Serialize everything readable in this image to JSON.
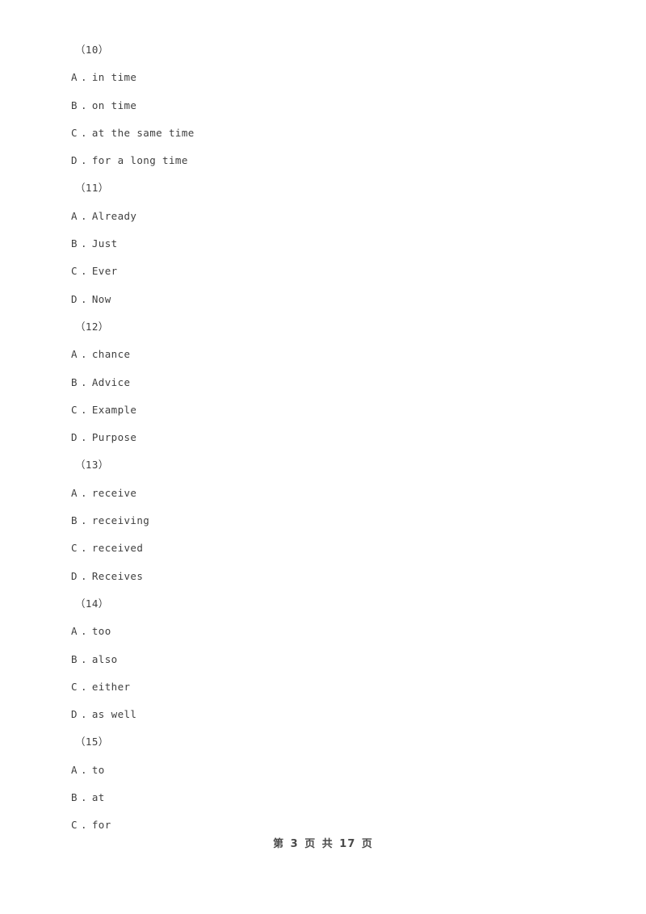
{
  "document": {
    "page_label_prefix": "第",
    "page_current": "3",
    "page_unit": "页",
    "page_total_prefix": "共",
    "page_total": "17",
    "page_total_unit": "页"
  },
  "questions": [
    {
      "number": "（10）",
      "options": [
        {
          "letter": "A",
          "separator": ".",
          "text": "in time"
        },
        {
          "letter": "B",
          "separator": ".",
          "text": "on time"
        },
        {
          "letter": "C",
          "separator": ".",
          "text": "at the same time"
        },
        {
          "letter": "D",
          "separator": ".",
          "text": "for a long time"
        }
      ]
    },
    {
      "number": "（11）",
      "options": [
        {
          "letter": "A",
          "separator": ".",
          "text": "Already"
        },
        {
          "letter": "B",
          "separator": ".",
          "text": "Just"
        },
        {
          "letter": "C",
          "separator": ".",
          "text": "Ever"
        },
        {
          "letter": "D",
          "separator": ".",
          "text": "Now"
        }
      ]
    },
    {
      "number": "（12）",
      "options": [
        {
          "letter": "A",
          "separator": ".",
          "text": "chance"
        },
        {
          "letter": "B",
          "separator": ".",
          "text": "Advice"
        },
        {
          "letter": "C",
          "separator": ".",
          "text": "Example"
        },
        {
          "letter": "D",
          "separator": ".",
          "text": "Purpose"
        }
      ]
    },
    {
      "number": "（13）",
      "options": [
        {
          "letter": "A",
          "separator": ".",
          "text": "receive"
        },
        {
          "letter": "B",
          "separator": ".",
          "text": "receiving"
        },
        {
          "letter": "C",
          "separator": ".",
          "text": "received"
        },
        {
          "letter": "D",
          "separator": ".",
          "text": "Receives"
        }
      ]
    },
    {
      "number": "（14）",
      "options": [
        {
          "letter": "A",
          "separator": ".",
          "text": "too"
        },
        {
          "letter": "B",
          "separator": ".",
          "text": "also"
        },
        {
          "letter": "C",
          "separator": ".",
          "text": "either"
        },
        {
          "letter": "D",
          "separator": ".",
          "text": "as well"
        }
      ]
    },
    {
      "number": "（15）",
      "options": [
        {
          "letter": "A",
          "separator": ".",
          "text": "to"
        },
        {
          "letter": "B",
          "separator": ".",
          "text": "at"
        },
        {
          "letter": "C",
          "separator": ".",
          "text": "for"
        }
      ]
    }
  ]
}
